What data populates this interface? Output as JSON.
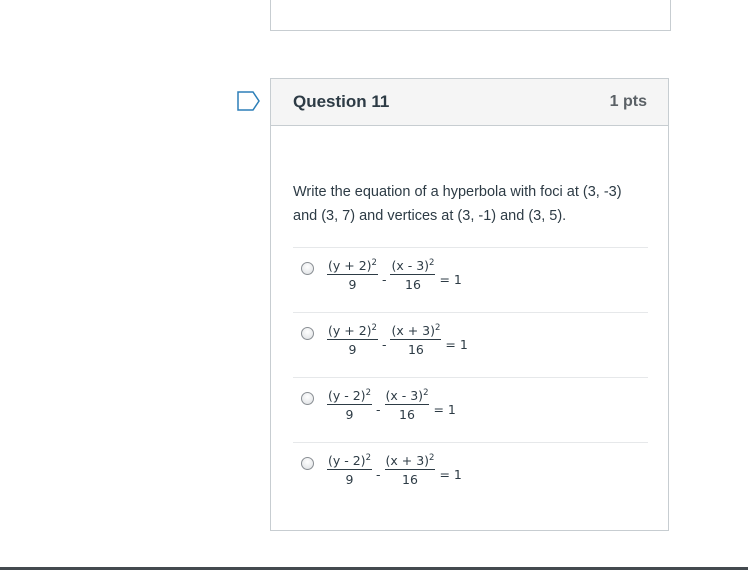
{
  "question": {
    "title": "Question 11",
    "points": "1 pts",
    "text": "Write the equation of a hyperbola with foci at (3, -3) and (3, 7) and vertices at (3, -1) and (3, 5)."
  },
  "answers": [
    {
      "num1": "(y + 2)",
      "exp1": "2",
      "den1": "9",
      "minus": "-",
      "num2": "(x - 3)",
      "exp2": "2",
      "den2": "16",
      "rhs": "= 1"
    },
    {
      "num1": "(y + 2)",
      "exp1": "2",
      "den1": "9",
      "minus": "-",
      "num2": "(x + 3)",
      "exp2": "2",
      "den2": "16",
      "rhs": "= 1"
    },
    {
      "num1": "(y - 2)",
      "exp1": "2",
      "den1": "9",
      "minus": "-",
      "num2": "(x - 3)",
      "exp2": "2",
      "den2": "16",
      "rhs": "= 1"
    },
    {
      "num1": "(y - 2)",
      "exp1": "2",
      "den1": "9",
      "minus": "-",
      "num2": "(x + 3)",
      "exp2": "2",
      "den2": "16",
      "rhs": "= 1"
    }
  ],
  "icons": {
    "flag": "bookmark-flag-icon",
    "radio": "radio-button-icon"
  },
  "colors": {
    "border": "#c7cdd1",
    "header_bg": "#f5f5f5",
    "flag": "#2d7fb8",
    "text": "#2d3b45"
  }
}
